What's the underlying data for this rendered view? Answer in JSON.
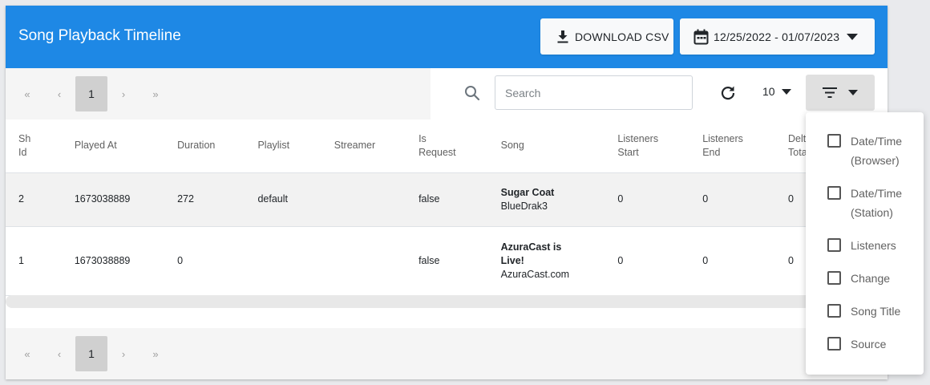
{
  "header": {
    "title": "Song Playback Timeline",
    "download_label": "DOWNLOAD CSV",
    "date_range": "12/25/2022 - 01/07/2023"
  },
  "pager": {
    "first": "«",
    "prev": "‹",
    "current": "1",
    "next": "›",
    "last": "»"
  },
  "toolbar": {
    "search_placeholder": "Search",
    "per_page": "10"
  },
  "table": {
    "headers": [
      "Sh Id",
      "Played At",
      "Duration",
      "Playlist",
      "Streamer",
      "Is Request",
      "Song",
      "Listeners Start",
      "Listeners End",
      "Delta Total"
    ],
    "rows": [
      {
        "sh_id": "2",
        "played_at": "1673038889",
        "duration": "272",
        "playlist": "default",
        "streamer": "",
        "is_request": "false",
        "song_title": "Sugar Coat",
        "song_artist": "BlueDrak3",
        "listeners_start": "0",
        "listeners_end": "0",
        "delta_total": "0"
      },
      {
        "sh_id": "1",
        "played_at": "1673038889",
        "duration": "0",
        "playlist": "",
        "streamer": "",
        "is_request": "false",
        "song_title": "AzuraCast is Live!",
        "song_artist": "AzuraCast.com",
        "listeners_start": "0",
        "listeners_end": "0",
        "delta_total": "0"
      }
    ]
  },
  "column_menu": {
    "items": [
      {
        "label": "Date/Time (Browser)",
        "checked": false
      },
      {
        "label": "Date/Time (Station)",
        "checked": false
      },
      {
        "label": "Listeners",
        "checked": false
      },
      {
        "label": "Change",
        "checked": false
      },
      {
        "label": "Song Title",
        "checked": false
      },
      {
        "label": "Source",
        "checked": false
      }
    ]
  },
  "colors": {
    "header_bg": "#1e88e5",
    "page_bg": "#e9eaed",
    "active_page": "#d0d0d0"
  },
  "icons": [
    "download-icon",
    "calendar-icon",
    "caret-down-icon",
    "search-icon",
    "refresh-icon",
    "filter-icon"
  ]
}
